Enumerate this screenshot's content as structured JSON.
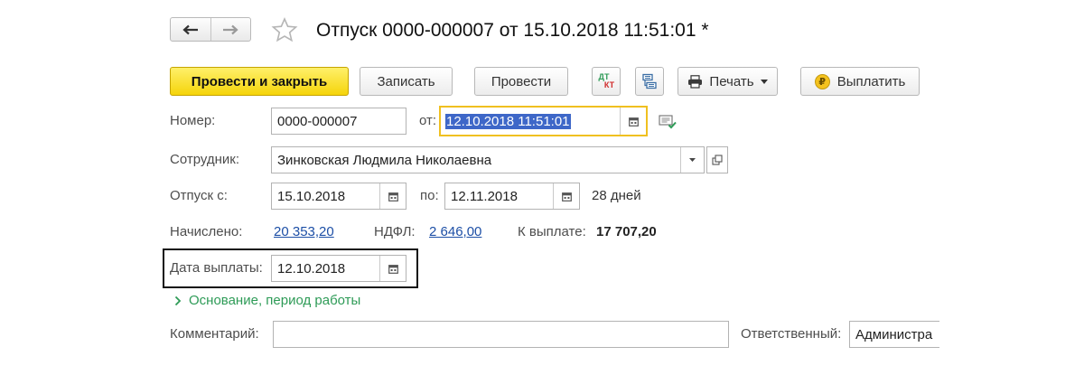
{
  "header": {
    "back_icon": "arrow-left-icon",
    "forward_icon": "arrow-right-icon",
    "favorite_icon": "star-outline-icon",
    "title": "Отпуск 0000-000007 от 15.10.2018 11:51:01 *"
  },
  "toolbar": {
    "post_close_label": "Провести и закрыть",
    "save_label": "Записать",
    "post_label": "Провести",
    "dt_kt_top": "ДТ",
    "dt_kt_bottom": "КТ",
    "structure_icon": "document-structure-icon",
    "print_label": "Печать",
    "print_icon": "printer-icon",
    "pay_label": "Выплатить",
    "pay_symbol": "₽"
  },
  "form": {
    "number_label": "Номер:",
    "number_value": "0000-000007",
    "date_label": "от:",
    "date_value": "12.10.2018 11:51:01",
    "employee_label": "Сотрудник:",
    "employee_value": "Зинковская Людмила Николаевна",
    "vacation_label": "Отпуск с:",
    "vacation_from": "15.10.2018",
    "vacation_to_label": "по:",
    "vacation_to": "12.11.2018",
    "vacation_days": "28 дней",
    "accrued_label": "Начислено:",
    "accrued_value": "20 353,20",
    "ndfl_label": "НДФЛ:",
    "ndfl_value": "2 646,00",
    "payout_label": "К выплате:",
    "payout_value": "17 707,20",
    "pay_date_label": "Дата выплаты:",
    "pay_date_value": "12.10.2018",
    "basis_label": "Основание, период работы",
    "comment_label": "Комментарий:",
    "comment_value": "",
    "responsible_label": "Ответственный:",
    "responsible_value": "Администра"
  },
  "colors": {
    "primary_button": "#f5d40a",
    "focus_border": "#f0c020",
    "highlight_border": "#111111",
    "link": "#1d4fa6",
    "basis_link": "#2e9b57",
    "selection": "#3e67c8"
  }
}
